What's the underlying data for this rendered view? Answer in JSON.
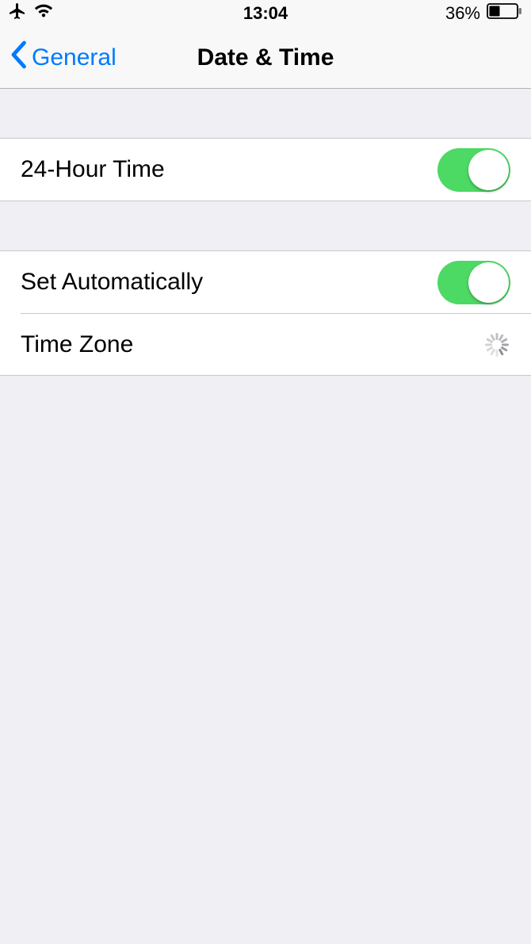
{
  "status": {
    "time": "13:04",
    "battery_percent": "36%"
  },
  "nav": {
    "back_label": "General",
    "title": "Date & Time"
  },
  "settings": {
    "group1": {
      "twenty_four_hour": {
        "label": "24-Hour Time",
        "on": true
      }
    },
    "group2": {
      "set_automatically": {
        "label": "Set Automatically",
        "on": true
      },
      "time_zone": {
        "label": "Time Zone",
        "loading": true
      }
    }
  }
}
